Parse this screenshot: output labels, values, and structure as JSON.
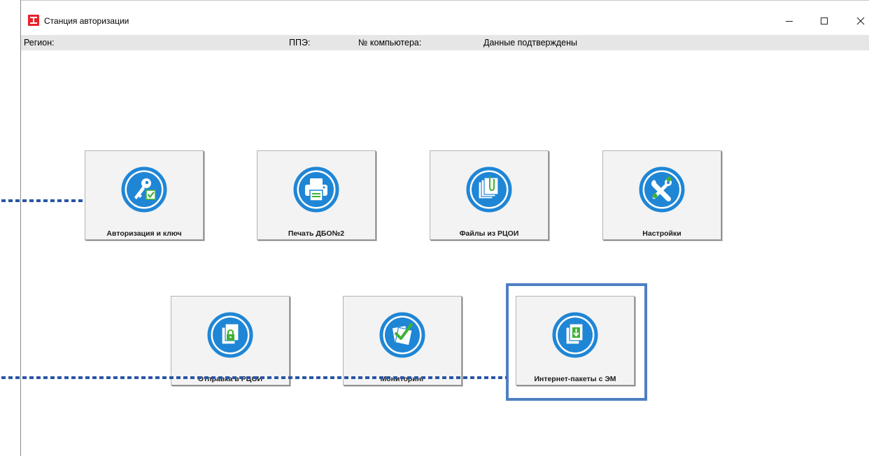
{
  "window": {
    "title": "Станция авторизации",
    "controls": {
      "minimize": "minimize-icon",
      "maximize": "maximize-icon",
      "close": "close-icon"
    }
  },
  "status": {
    "region": "Регион:",
    "ppe": "ППЭ:",
    "computer": "№ компьютера:",
    "confirmed": "Данные подтверждены"
  },
  "tiles": [
    {
      "label": "Авторизация и ключ",
      "icon": "key-check-icon"
    },
    {
      "label": "Печать ДБО№2",
      "icon": "printer-icon"
    },
    {
      "label": "Файлы из РЦОИ",
      "icon": "files-clip-icon"
    },
    {
      "label": "Настройки",
      "icon": "tools-gears-icon"
    },
    {
      "label": "Отправка в РЦОИ",
      "icon": "locked-files-icon"
    },
    {
      "label": "Мониторинг",
      "icon": "check-pages-icon"
    },
    {
      "label": "Интернет-пакеты с ЭМ",
      "icon": "download-pages-icon"
    }
  ],
  "colors": {
    "icon_blue": "#1f86d6",
    "icon_green": "#3fb234",
    "highlight": "#4f7fc2",
    "pointer_dots": "#2a55a4",
    "app_red": "#e8212b"
  }
}
